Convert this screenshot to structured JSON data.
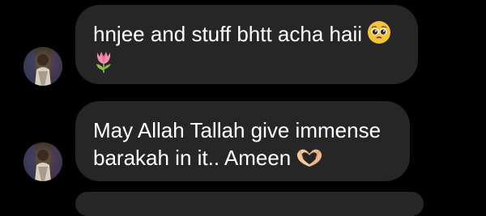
{
  "messages": [
    {
      "line1": "hnjee and stuff bhtt acha haii",
      "emoji1": "pleading-face-icon",
      "emoji2": "tulip-icon"
    },
    {
      "line1": "May Allah Tallah give immense",
      "line2": "barakah in it.. Ameen",
      "emoji1": "heart-hands-icon"
    }
  ],
  "colors": {
    "background": "#000000",
    "bubble": "#262626",
    "text": "#ffffff"
  }
}
